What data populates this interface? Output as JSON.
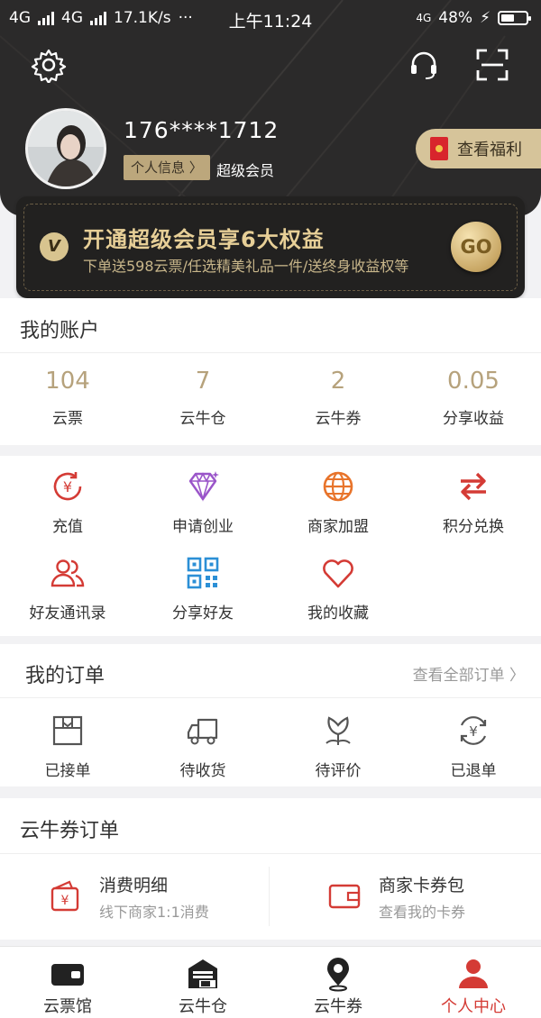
{
  "status_bar": {
    "network_1": "4G",
    "network_2": "4G",
    "speed": "17.1K/s",
    "dots": "···",
    "time": "上午11:24",
    "volte": "4G",
    "battery": "48%"
  },
  "header": {
    "settings_icon": "gear-icon",
    "service_icon": "headset-icon",
    "scan_icon": "scan-icon",
    "phone": "176****1712",
    "info_button": "个人信息 〉",
    "member_level": "超级会员",
    "welfare_button": "查看福利"
  },
  "vip_banner": {
    "badge": "V",
    "title": "开通超级会员享6大权益",
    "subtitle": "下单送598云票/任选精美礼品一件/送终身收益权等",
    "go": "GO"
  },
  "account": {
    "title": "我的账户",
    "stats": [
      {
        "value": "104",
        "label": "云票"
      },
      {
        "value": "7",
        "label": "云牛仓"
      },
      {
        "value": "2",
        "label": "云牛券"
      },
      {
        "value": "0.05",
        "label": "分享收益"
      }
    ]
  },
  "services": [
    {
      "label": "充值",
      "icon": "recharge-icon"
    },
    {
      "label": "申请创业",
      "icon": "diamond-icon"
    },
    {
      "label": "商家加盟",
      "icon": "globe-icon"
    },
    {
      "label": "积分兑换",
      "icon": "exchange-icon"
    },
    {
      "label": "好友通讯录",
      "icon": "contacts-icon"
    },
    {
      "label": "分享好友",
      "icon": "qrcode-icon"
    },
    {
      "label": "我的收藏",
      "icon": "heart-icon"
    }
  ],
  "orders": {
    "title": "我的订单",
    "view_all": "查看全部订单",
    "items": [
      {
        "label": "已接单",
        "icon": "received-icon"
      },
      {
        "label": "待收货",
        "icon": "truck-icon"
      },
      {
        "label": "待评价",
        "icon": "flower-icon"
      },
      {
        "label": "已退单",
        "icon": "refund-icon"
      }
    ]
  },
  "coupon_orders": {
    "title": "云牛券订单",
    "left": {
      "title": "消费明细",
      "subtitle": "线下商家1:1消费"
    },
    "right": {
      "title": "商家卡券包",
      "subtitle": "查看我的卡券"
    }
  },
  "tabbar": [
    {
      "label": "云票馆",
      "icon": "wallet-icon"
    },
    {
      "label": "云牛仓",
      "icon": "warehouse-icon"
    },
    {
      "label": "云牛券",
      "icon": "location-pin-icon"
    },
    {
      "label": "个人中心",
      "icon": "person-icon"
    }
  ],
  "colors": {
    "accent": "#b6a27c",
    "red": "#d43b35",
    "dark": "#2b2a2a"
  }
}
